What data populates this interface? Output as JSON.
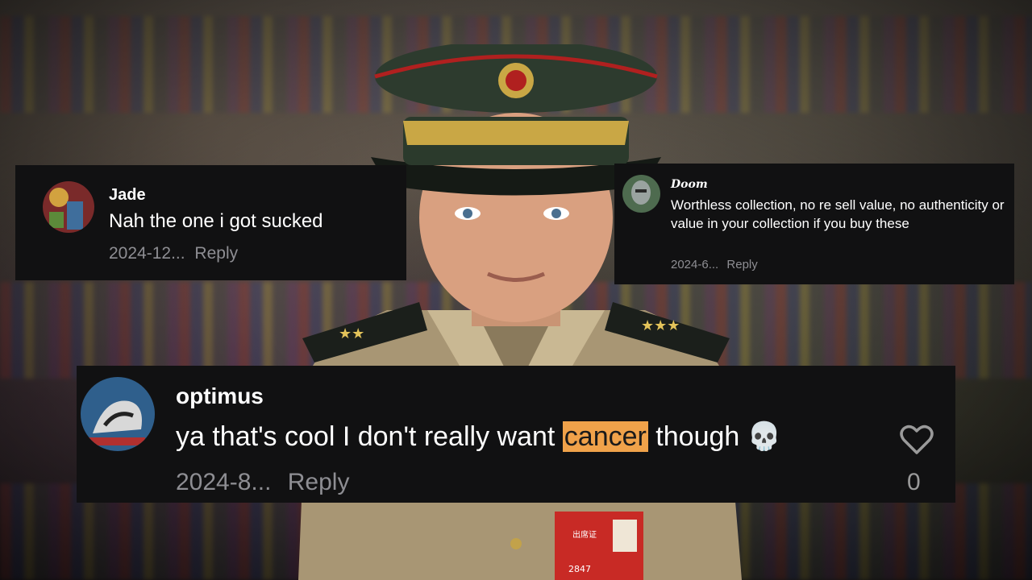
{
  "comments": [
    {
      "username": "Jade",
      "text": "Nah the one i got sucked",
      "date": "2024-12...",
      "reply": "Reply"
    },
    {
      "username": "Doom",
      "text": "Worthless collection, no re sell value, no authenticity or value in your collection if you buy these",
      "date": "2024-6...",
      "reply": "Reply"
    },
    {
      "username": "optimus",
      "text_before": "ya that's cool I don't really want ",
      "text_highlight": "cancer",
      "text_after": " though",
      "emoji": "💀",
      "date": "2024-8...",
      "reply": "Reply",
      "likes": "0"
    }
  ],
  "badge": {
    "number": "2847",
    "label": "出席证"
  },
  "colors": {
    "card_bg": "#111112",
    "highlight": "#f0a24a",
    "meta_text": "#8e8e93"
  }
}
